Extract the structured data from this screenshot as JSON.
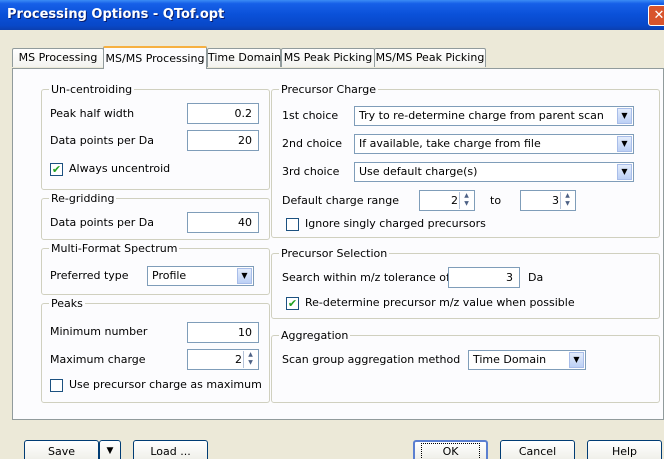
{
  "window": {
    "title": "Processing Options - QTof.opt",
    "close_glyph": "✕"
  },
  "tabs": [
    {
      "label": "MS Processing"
    },
    {
      "label": "MS/MS Processing"
    },
    {
      "label": "Time Domain"
    },
    {
      "label": "MS Peak Picking"
    },
    {
      "label": "MS/MS Peak Picking"
    }
  ],
  "uncentroiding": {
    "title": "Un-centroiding",
    "peak_half_width_label": "Peak half width",
    "peak_half_width": "0.2",
    "points_per_da_label": "Data points per Da",
    "points_per_da": "20",
    "always_uncentroid_label": "Always uncentroid",
    "always_uncentroid_checked": true
  },
  "regridding": {
    "title": "Re-gridding",
    "points_per_da_label": "Data points per Da",
    "points_per_da": "40"
  },
  "multiformat": {
    "title": "Multi-Format Spectrum",
    "preferred_type_label": "Preferred type",
    "preferred_type": "Profile"
  },
  "peaks": {
    "title": "Peaks",
    "min_number_label": "Minimum number",
    "min_number": "10",
    "max_charge_label": "Maximum charge",
    "max_charge": "2",
    "use_precursor_label": "Use precursor charge as maximum",
    "use_precursor_checked": false
  },
  "precursor_charge": {
    "title": "Precursor Charge",
    "first_label": "1st choice",
    "first_value": "Try to re-determine charge from parent scan",
    "second_label": "2nd choice",
    "second_value": "If available, take charge from file",
    "third_label": "3rd choice",
    "third_value": "Use default charge(s)",
    "range_label": "Default charge range",
    "range_from": "2",
    "range_to_label": "to",
    "range_to": "3",
    "ignore_singly_label": "Ignore singly charged precursors",
    "ignore_singly_checked": false
  },
  "precursor_selection": {
    "title": "Precursor Selection",
    "tolerance_label": "Search within m/z tolerance of",
    "tolerance": "3",
    "tolerance_unit": "Da",
    "redetermine_label": "Re-determine precursor m/z value when possible",
    "redetermine_checked": true
  },
  "aggregation": {
    "title": "Aggregation",
    "method_label": "Scan group aggregation method",
    "method": "Time Domain"
  },
  "buttons": {
    "save": "Save",
    "load": "Load ...",
    "ok": "OK",
    "cancel": "Cancel",
    "help": "Help"
  },
  "glyphs": {
    "check": "✔",
    "down": "▼",
    "up": "▲"
  }
}
